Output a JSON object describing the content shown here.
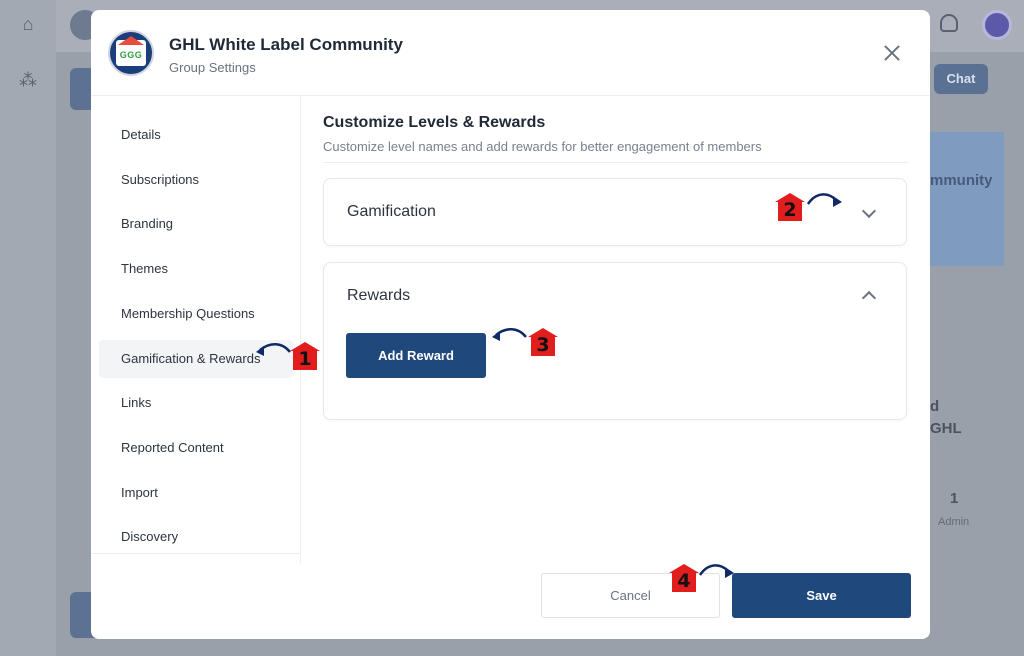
{
  "background": {
    "chat_label": "Chat",
    "banner_text": "mmunity",
    "side_text_1": "d",
    "side_text_2": "GHL",
    "count_value": "1",
    "count_label": "Admin"
  },
  "modal": {
    "title": "GHL White Label Community",
    "subtitle": "Group Settings",
    "logo_text": "GGG"
  },
  "sidebar": {
    "items": [
      {
        "label": "Details"
      },
      {
        "label": "Subscriptions"
      },
      {
        "label": "Branding"
      },
      {
        "label": "Themes"
      },
      {
        "label": "Membership Questions"
      },
      {
        "label": "Gamification & Rewards"
      },
      {
        "label": "Links"
      },
      {
        "label": "Reported Content"
      },
      {
        "label": "Import"
      },
      {
        "label": "Discovery"
      }
    ],
    "active": "Gamification & Rewards"
  },
  "content": {
    "title": "Customize Levels & Rewards",
    "subtitle": "Customize level names and add rewards for better engagement of members",
    "panels": {
      "gamification": {
        "title": "Gamification",
        "state": "collapsed"
      },
      "rewards": {
        "title": "Rewards",
        "state": "expanded",
        "add_button": "Add Reward"
      }
    }
  },
  "footer": {
    "cancel_label": "Cancel",
    "save_label": "Save"
  },
  "markers": [
    "1",
    "2",
    "3",
    "4"
  ],
  "colors": {
    "primary": "#1f487c",
    "marker": "#e11d1d",
    "arrow": "#0f2a66"
  }
}
